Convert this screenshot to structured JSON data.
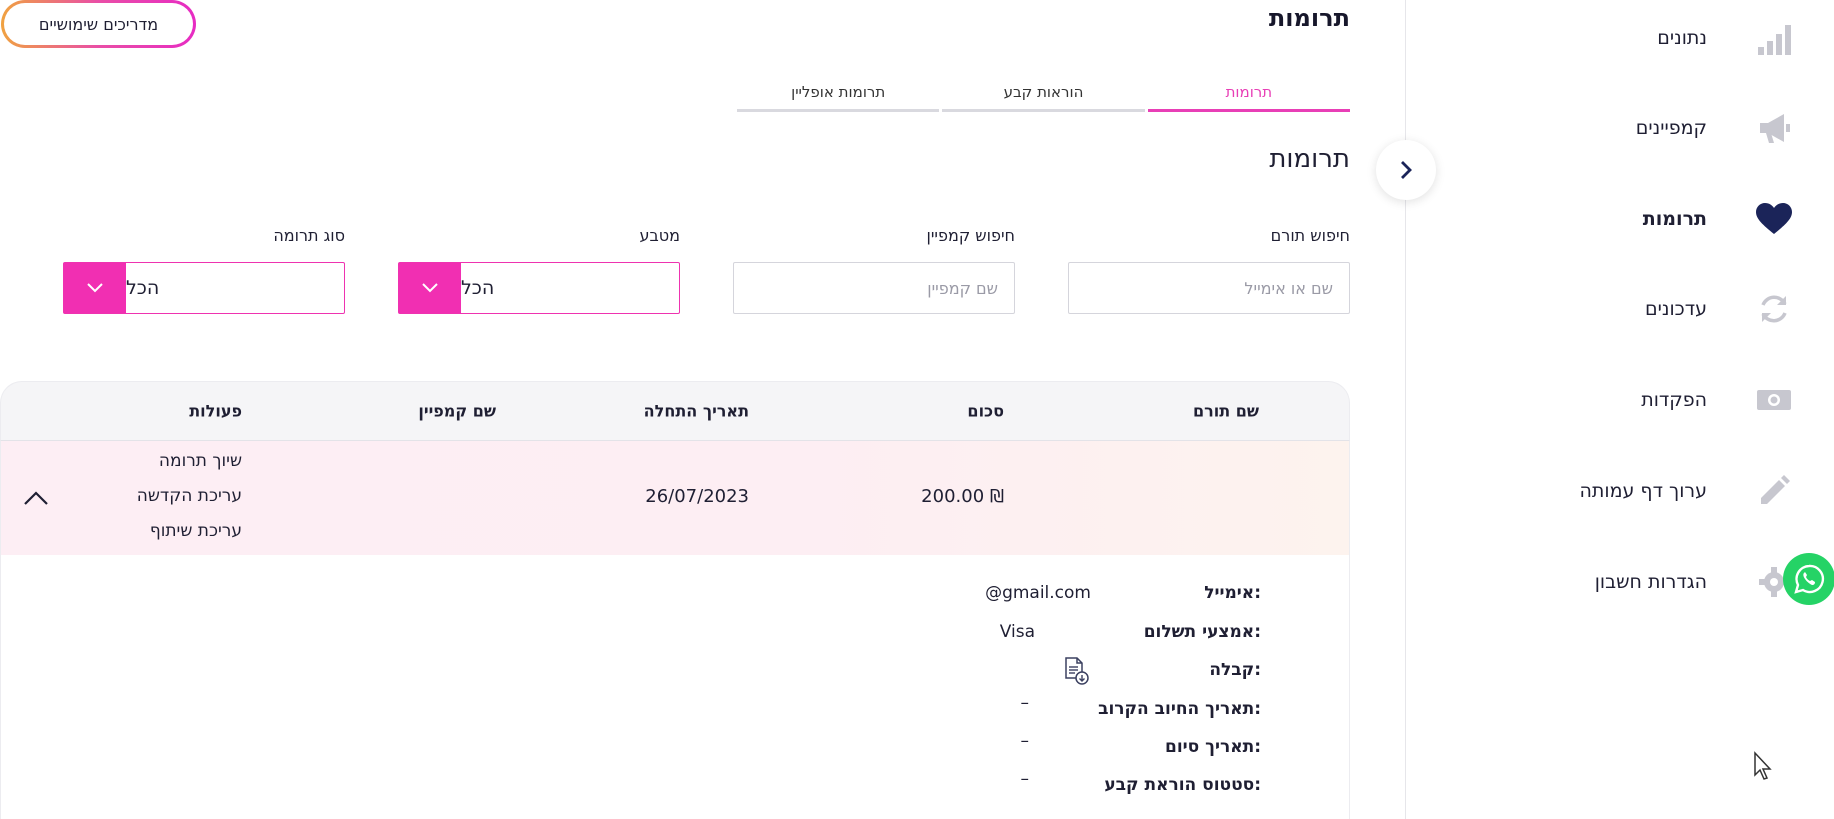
{
  "header": {
    "title": "תרומות",
    "guides_button": "מדריכים שימושיים"
  },
  "tabs": [
    {
      "label": "תרומות",
      "active": true
    },
    {
      "label": "הוראות קבע",
      "active": false
    },
    {
      "label": "תרומות אופליין",
      "active": false
    }
  ],
  "section_title": "תרומות",
  "filters": {
    "donor_search": {
      "label": "חיפוש תורם",
      "placeholder": "שם או אימייל"
    },
    "campaign_search": {
      "label": "חיפוש קמפיין",
      "placeholder": "שם קמפיין"
    },
    "currency": {
      "label": "מטבע",
      "value": "הכל"
    },
    "donation_type": {
      "label": "סוג תרומה",
      "value": "הכל"
    }
  },
  "table": {
    "columns": {
      "donor_name": "שם תורם",
      "amount": "סכום",
      "start_date": "תאריך התחלה",
      "campaign_name": "שם קמפיין",
      "actions": "פעולות"
    },
    "rows": [
      {
        "donor_name": "",
        "amount": "200.00 ₪",
        "start_date": "26/07/2023",
        "campaign_name": "",
        "actions": [
          "שיוך תרומה",
          "עריכת הקדשה",
          "עריכת שיתוף"
        ]
      }
    ],
    "details": {
      "email_label": "אימייל:",
      "email_value": "@gmail.com",
      "payment_label": "אמצעי תשלום:",
      "payment_value": "Visa",
      "receipt_label": "קבלה:",
      "next_charge_label": "תאריך החיוב הקרוב:",
      "next_charge_value": "–",
      "end_date_label": "תאריך סיום:",
      "end_date_value": "–",
      "standing_order_label": "סטטוס הוראת קבע:",
      "standing_order_value": "–"
    }
  },
  "sidebar": {
    "items": [
      {
        "label": "נתונים",
        "icon": "bar-chart-icon",
        "active": false
      },
      {
        "label": "קמפיינים",
        "icon": "megaphone-icon",
        "active": false
      },
      {
        "label": "תרומות",
        "icon": "heart-icon",
        "active": true
      },
      {
        "label": "עדכונים",
        "icon": "refresh-icon",
        "active": false
      },
      {
        "label": "הפקדות",
        "icon": "cash-icon",
        "active": false
      },
      {
        "label": "ערוך דף עמותה",
        "icon": "pencil-icon",
        "active": false
      },
      {
        "label": "הגדרות חשבון",
        "icon": "gear-icon",
        "active": false
      }
    ]
  },
  "colors": {
    "accent_pink": "#f12fb2",
    "tab_active": "#e83fb6",
    "nav_active_icon": "#1b2459",
    "nav_icon": "#c7c7cf",
    "whatsapp": "#25d366"
  }
}
